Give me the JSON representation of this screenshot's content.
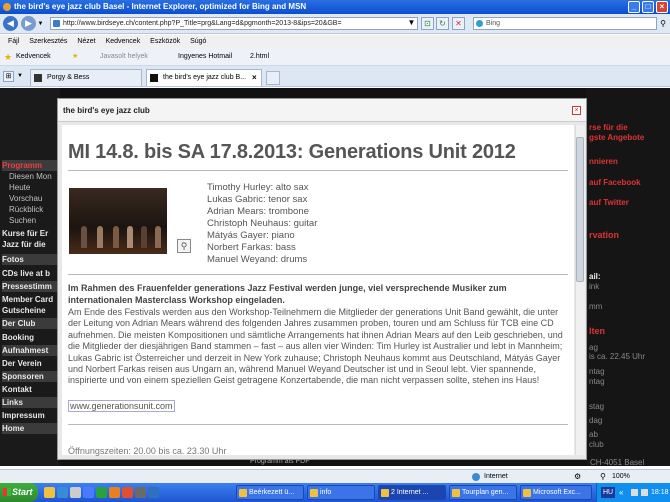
{
  "window": {
    "title": "the bird's eye jazz club Basel - Internet Explorer, optimized for Bing and MSN"
  },
  "address": {
    "url": "http://www.birdseye.ch/content.php?P_Title=prg&Lang=d&pgmonth=2013-8&ips=20&GB=",
    "search_placeholder": "Bing"
  },
  "menu": [
    "Fájl",
    "Szerkesztés",
    "Nézet",
    "Kedvencek",
    "Eszközök",
    "Súgó"
  ],
  "favorites": {
    "label": "Kedvencek",
    "items": [
      "Javasolt helyek",
      "Ingyenes Hotmail",
      "2.html"
    ]
  },
  "tabs": [
    "Porgy & Bess",
    "the bird's eye jazz club B..."
  ],
  "left_nav": [
    "Programm",
    "Diesen Mon",
    "Heute",
    "Vorschau",
    "Rückblick",
    "Suchen",
    "Kurse für Er",
    "Jazz für die",
    "Fotos",
    "CDs live at b",
    "Pressestimm",
    "Member Card",
    "Gutscheine",
    "Der Club",
    "Booking",
    "Aufnahmest",
    "Der Verein",
    "Sponsoren",
    "Kontakt",
    "Links",
    "Impressum",
    "Home"
  ],
  "right_side": [
    "rse für die",
    "gste Angebote",
    "nnieren",
    "auf Facebook",
    "auf Twitter",
    "rvation",
    "ail:",
    "ink",
    "mm",
    "lten",
    "ag",
    "is ca. 22.45 Uhr",
    "ntag",
    "ntag",
    "stag",
    "dag",
    "ab",
    "club",
    "CH-4051 Basel"
  ],
  "modal": {
    "title": "the bird's eye jazz club",
    "close": "×",
    "heading": "MI 14.8. bis SA 17.8.2013: Generations Unit 2012",
    "band": [
      "Timothy Hurley: alto sax",
      "Lukas Gabric: tenor sax",
      "Adrian Mears: trombone",
      "Christoph Neuhaus: guitar",
      "Mátyás Gayer: piano",
      "Norbert Farkas: bass",
      "Manuel Weyand: drums"
    ],
    "lead": "Im Rahmen des Frauenfelder generations Jazz Festival werden junge, viel versprechende Musiker zum internationalen Masterclass Workshop eingeladen.",
    "body": "Am Ende des Festivals werden aus den Workshop-Teilnehmern die Mitglieder der generations Unit Band gewählt, die unter der Leitung von Adrian Mears während des folgenden Jahres zusammen proben, touren und am Schluss für TCB eine CD aufnehmen. Die meisten Kompositionen und sämtliche Arrangements hat ihnen Adrian Mears auf den Leib geschrieben, und die Mitglieder der diesjährigen Band stammen – fast – aus allen vier Winden: Tim Hurley ist Australier und lebt in Mannheim; Lukas Gabric ist Österreicher und derzeit in New York zuhause; Christoph Neuhaus kommt aus Deutschland, Mátyás Gayer und Norbert Farkas reisen aus Ungarn an, während Manuel Weyand Deutscher ist und in Seoul lebt. Vier spannende, inspirierte und von einem speziellen Geist getragene Konzertabende, die man nicht verpassen sollte, stehen ins Haus!",
    "link": "www.generationsunit.com",
    "hours": "Öffnungszeiten: 20.00 bis ca. 23.30 Uhr"
  },
  "page_bottom": "Programm als PDF",
  "status": {
    "zone": "Internet",
    "zoom": "100%"
  },
  "taskbar": {
    "start": "Start",
    "tasks": [
      "Beérkezett ü...",
      "info",
      "2 Internet ...",
      "Tourplan gen...",
      "Microsoft Exc..."
    ],
    "lang": "HU",
    "time": "18:18"
  }
}
